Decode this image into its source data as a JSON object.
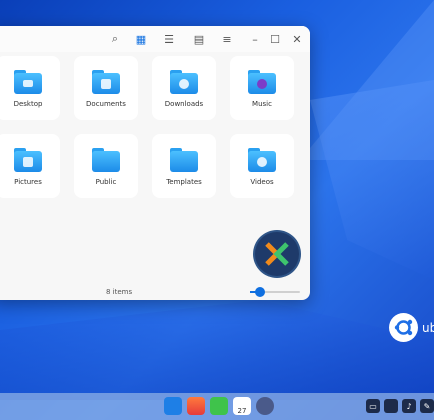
{
  "toolbar": {
    "buttons": [
      {
        "name": "search",
        "glyph": "⌕"
      },
      {
        "name": "icon-view",
        "glyph": "▦"
      },
      {
        "name": "list-view",
        "glyph": "☰"
      },
      {
        "name": "tree-view",
        "glyph": "▤"
      },
      {
        "name": "menu",
        "glyph": "≡"
      },
      {
        "name": "minimize",
        "glyph": "–"
      },
      {
        "name": "maximize",
        "glyph": "☐"
      },
      {
        "name": "close",
        "glyph": "✕"
      }
    ]
  },
  "folders": [
    {
      "label": "Desktop",
      "icon": "desktop-icon"
    },
    {
      "label": "Documents",
      "icon": "document-icon"
    },
    {
      "label": "Downloads",
      "icon": "download-icon"
    },
    {
      "label": "Music",
      "icon": "music-icon"
    },
    {
      "label": "Pictures",
      "icon": "picture-icon"
    },
    {
      "label": "Public",
      "icon": "public-icon"
    },
    {
      "label": "Templates",
      "icon": "template-icon"
    },
    {
      "label": "Videos",
      "icon": "video-icon"
    }
  ],
  "status": {
    "items_text": "8 items",
    "zoom_level": 0.2
  },
  "brand": {
    "text": "ub"
  },
  "calendar": {
    "day": "27"
  },
  "colors": {
    "accent": "#0f6fe0",
    "folder": "#2aa0f0"
  }
}
